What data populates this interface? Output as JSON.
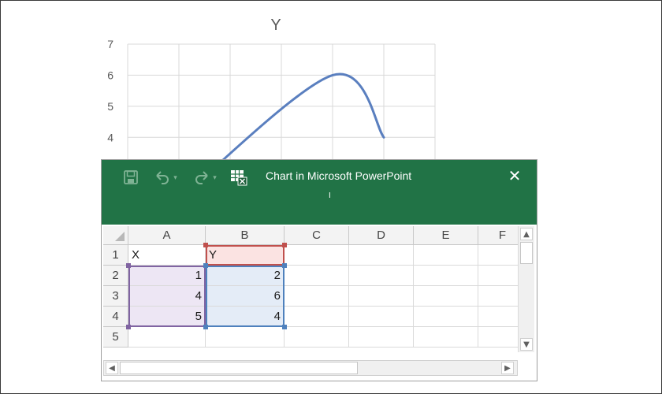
{
  "chart_data": {
    "type": "line",
    "title": "Y",
    "x": [
      1,
      4,
      5
    ],
    "series": [
      {
        "values": [
          2,
          6,
          4
        ]
      }
    ],
    "ylim": [
      0,
      7
    ],
    "yticks_visible": [
      "4",
      "5",
      "6",
      "7"
    ],
    "smooth": true,
    "grid": true,
    "color": "#5a7fbf"
  },
  "window": {
    "title": "Chart in Microsoft PowerPoint",
    "cursor_glyph": "I",
    "accent": "#217346",
    "icons": {
      "save": "save-icon",
      "undo": "undo-icon",
      "redo": "redo-icon",
      "edit_in_excel": "edit-data-in-excel-icon",
      "close": "close-icon"
    }
  },
  "sheet": {
    "columns": [
      "A",
      "B",
      "C",
      "D",
      "E",
      "F"
    ],
    "rows": [
      "1",
      "2",
      "3",
      "4",
      "5"
    ],
    "cells": {
      "A1": "X",
      "B1": "Y",
      "A2": "1",
      "B2": "2",
      "A3": "4",
      "B3": "6",
      "A4": "5",
      "B4": "4"
    },
    "ranges": {
      "series_name": {
        "color": "#c0504d"
      },
      "x_values": {
        "color": "#8064a2"
      },
      "y_values": {
        "color": "#4f81bd"
      }
    }
  }
}
